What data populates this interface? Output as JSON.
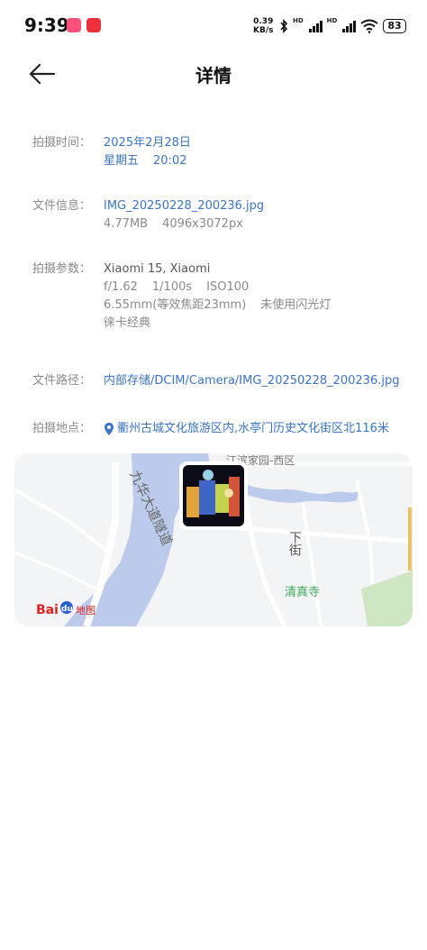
{
  "status_bar": {
    "time": "9:39",
    "net_speed_value": "0.39",
    "net_speed_unit": "KB/s",
    "sim1_tag": "HD",
    "sim2_tag": "HD",
    "battery": "83"
  },
  "header": {
    "title": "详情"
  },
  "details": {
    "time": {
      "label": "拍摄时间：",
      "date": "2025年2月28日",
      "weekday": "星期五",
      "clock": "20:02"
    },
    "file": {
      "label": "文件信息：",
      "name": "IMG_20250228_200236.jpg",
      "size": "4.77MB",
      "resolution": "4096x3072px"
    },
    "params": {
      "label": "拍摄参数：",
      "camera": "Xiaomi 15, Xiaomi",
      "aperture": "f/1.62",
      "shutter": "1/100s",
      "iso": "ISO100",
      "focal": "6.55mm(等效焦距23mm)",
      "flash": "未使用闪光灯",
      "style": "徕卡经典"
    },
    "path": {
      "label": "文件路径：",
      "value": "内部存储/DCIM/Camera/IMG_20250228_200236.jpg"
    },
    "location": {
      "label": "拍摄地点：",
      "value": "衢州古城文化旅游区内,水亭门历史文化街区北116米"
    }
  },
  "map": {
    "labels": {
      "road_main": "九华大道隧道",
      "area_top": "江滨家园-西区",
      "street": "下街",
      "temple": "清真寺",
      "logo_bai": "Bai",
      "logo_du": "du",
      "logo_map": "地图"
    },
    "colors": {
      "water": "#bccbeb",
      "temple_text": "#3aa757",
      "park": "#cfe6c2",
      "pin": "#3a73c4"
    }
  }
}
